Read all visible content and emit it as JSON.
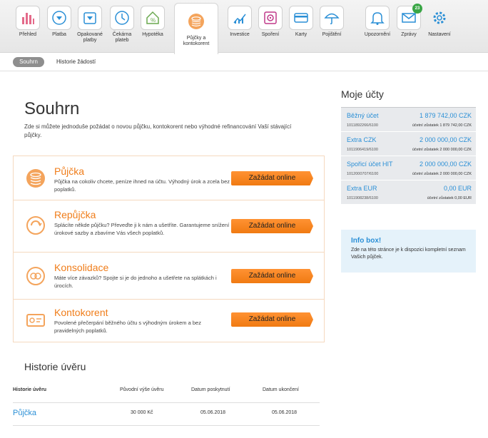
{
  "nav": [
    {
      "label": "Přehled",
      "icon": "bar-chart-icon"
    },
    {
      "label": "Platba",
      "icon": "payment-arrow-icon"
    },
    {
      "label": "Opakované platby",
      "icon": "recurring-payment-icon"
    },
    {
      "label": "Čekárna plateb",
      "icon": "clock-icon"
    },
    {
      "label": "Hypotéka",
      "icon": "house-percent-icon"
    },
    {
      "label": "Půjčky a kontokorent",
      "icon": "coins-icon"
    },
    {
      "label": "Investice",
      "icon": "invest-chart-icon"
    },
    {
      "label": "Spoření",
      "icon": "safe-icon"
    },
    {
      "label": "Karty",
      "icon": "card-icon"
    },
    {
      "label": "Pojištění",
      "icon": "umbrella-icon"
    },
    {
      "label": "Upozornění",
      "icon": "bell-icon"
    },
    {
      "label": "Zprávy",
      "icon": "envelope-icon",
      "badge": "23"
    },
    {
      "label": "Nastavení",
      "icon": "gear-icon"
    }
  ],
  "subnav": {
    "active": "Souhrn",
    "history": "Historie žádostí"
  },
  "main": {
    "title": "Souhrn",
    "intro": "Zde si můžete jednoduše požádat o novou půjčku, kontokorent nebo výhodné refinancování Vaší stávající půjčky."
  },
  "products": [
    {
      "title": "Půjčka",
      "desc": "Půjčka na cokoliv chcete, peníze ihned na účtu. Výhodný úrok a zcela bez poplatků.",
      "button": "Zažádat online"
    },
    {
      "title": "Repůjčka",
      "desc": "Splácíte někde půjčku? Převeďte ji k nám a ušetříte. Garantujeme snížení úrokové sazby a zbavíme Vás všech poplatků.",
      "button": "Zažádat online"
    },
    {
      "title": "Konsolidace",
      "desc": "Máte více závazků? Spojte si je do jednoho a ušetřete na splátkách i úrocích.",
      "button": "Zažádat online"
    },
    {
      "title": "Kontokorent",
      "desc": "Povolené přečerpání běžného účtu s výhodným úrokem a bez pravidelných poplatků.",
      "button": "Zažádat online"
    }
  ],
  "history": {
    "title": "Historie úvěru",
    "columns": [
      "Historie úvěru",
      "Původní výše úvěru",
      "Datum poskytnutí",
      "Datum ukončení"
    ],
    "rows": [
      {
        "name": "Půjčka",
        "amount": "30 000 Kč",
        "granted": "05.06.2018",
        "ended": "05.06.2018"
      }
    ]
  },
  "accounts": {
    "title": "Moje účty",
    "items": [
      {
        "name": "Běžný účet",
        "balance": "1 879 742,00 CZK",
        "number": "1011892266/6100",
        "available": "účetní zůstatek 1 879 742,00 CZK"
      },
      {
        "name": "Extra CZK",
        "balance": "2 000 000,00 CZK",
        "number": "1011906419/6100",
        "available": "účetní zůstatek 2 000 000,00 CZK"
      },
      {
        "name": "Spořicí účet HIT",
        "balance": "2 000 000,00 CZK",
        "number": "1012000707/6100",
        "available": "účetní zůstatek 2 000 000,00 CZK"
      },
      {
        "name": "Extra EUR",
        "balance": "0,00 EUR",
        "number": "1011908238/6100",
        "available": "účetní zůstatek 0,00 EUR"
      }
    ]
  },
  "info": {
    "title": "Info box!",
    "text": "Zde na této stránce je k dispozici kompletní seznam Vašich půjček."
  },
  "colors": {
    "accent": "#f07d1a",
    "link": "#2a8fd6",
    "badge": "#3aa646"
  }
}
